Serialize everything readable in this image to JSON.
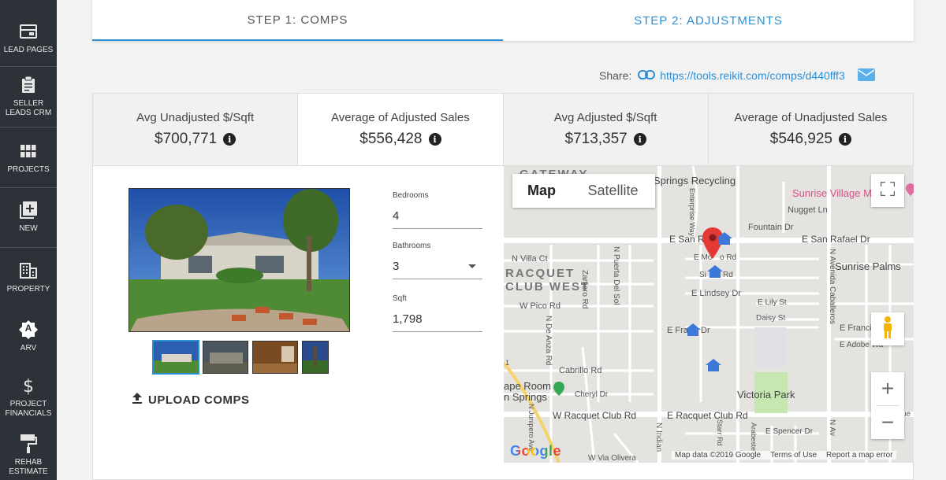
{
  "sidebar": {
    "items": [
      {
        "label": "LEAD PAGES",
        "icon": "lead-pages-icon"
      },
      {
        "label": "SELLER LEADS CRM",
        "icon": "clipboard-icon"
      },
      {
        "label": "PROJECTS",
        "icon": "grid-icon"
      },
      {
        "label": "NEW",
        "icon": "add-box-icon"
      },
      {
        "label": "PROPERTY",
        "icon": "building-icon"
      },
      {
        "label": "ARV",
        "icon": "arv-badge-icon"
      },
      {
        "label": "PROJECT FINANCIALS",
        "icon": "dollar-icon"
      },
      {
        "label": "REHAB ESTIMATE",
        "icon": "paint-roller-icon"
      }
    ],
    "arv_badge_letter": "A"
  },
  "steps": {
    "step1": "STEP 1: COMPS",
    "step2": "STEP 2: ADJUSTMENTS"
  },
  "share": {
    "label": "Share:",
    "url": "https://tools.reikit.com/comps/d440fff3"
  },
  "stats": [
    {
      "label": "Avg Unadjusted $/Sqft",
      "value": "$700,771"
    },
    {
      "label": "Average of Adjusted Sales",
      "value": "$556,428"
    },
    {
      "label": "Avg Adjusted $/Sqft",
      "value": "$713,357"
    },
    {
      "label": "Average of Unadjusted Sales",
      "value": "$546,925"
    }
  ],
  "info_glyph": "i",
  "fields": {
    "bedrooms": {
      "label": "Bedrooms",
      "value": "4"
    },
    "bathrooms": {
      "label": "Bathrooms",
      "value": "3"
    },
    "sqft": {
      "label": "Sqft",
      "value": "1,798"
    }
  },
  "upload_label": "UPLOAD COMPS",
  "map": {
    "type_map": "Map",
    "type_satellite": "Satellite",
    "zoom_in": "+",
    "zoom_out": "−",
    "google": "Google",
    "footer": {
      "data": "Map data ©2019 Google",
      "terms": "Terms of Use",
      "report": "Report a map error"
    },
    "labels": {
      "gateway": "GATEWAY",
      "racquet": "RACQUET",
      "club_west": "CLUB WEST",
      "springs_recycling": "Springs Recycling",
      "sunrise_village": "Sunrise Village M",
      "nugget": "Nugget Ln",
      "fountain": "Fountain Dr",
      "e_san_rafael_left": "E San Ra",
      "e_san_rafael_right": "E San Rafael Dr",
      "e_molino": "E Mo",
      "e_molino_rd": "o Rd",
      "sierra": "Si",
      "sierra_rd": "Rd",
      "n_villa": "N Villa Ct",
      "sunrise_palms": "Sunrise Palms",
      "e_lindsey": "E Lindsey Dr",
      "e_lily": "E Lily St",
      "daisy": "Daisy St",
      "w_pico": "W Pico Rd",
      "e_francis_left": "E Fra",
      "e_francis_dr": "Dr",
      "e_francis_right": "E Francis",
      "e_adobe": "E Adobe Wa",
      "cabrillo": "Cabrillo Rd",
      "cheryl": "Cheryl Dr",
      "victoria_park": "Victoria Park",
      "ape_room": "ape Room",
      "n_springs": "n Springs",
      "w_racquet": "W Racquet Club Rd",
      "e_racquet": "E Racquet Club Rd",
      "e_spencer": "E Spencer Dr",
      "w_via_olivera": "W Via Olivera",
      "n_puerta": "N Puerta Del Sol",
      "zanjero": "Zanjero Rd",
      "n_de_anza": "N De Anza Rd",
      "n_avenida": "N Avenida Caballeros",
      "enterprise": "Enterprise Way",
      "n_indian": "N Indian",
      "starr": "Starr Rd",
      "arabeste": "Arabeste",
      "n_av_small": "N Av",
      "n_junipero": "N Junipero Ave",
      "ue": "ue",
      "route": "1"
    }
  }
}
